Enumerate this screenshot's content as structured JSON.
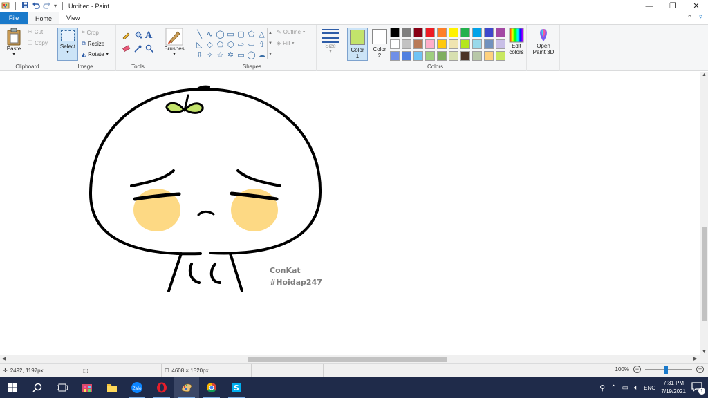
{
  "window": {
    "title": "Untitled - Paint"
  },
  "tabs": [
    {
      "label": "File"
    },
    {
      "label": "Home"
    },
    {
      "label": "View"
    }
  ],
  "ribbon": {
    "clipboard": {
      "label": "Clipboard",
      "paste": "Paste",
      "cut": "Cut",
      "copy": "Copy"
    },
    "image": {
      "label": "Image",
      "select": "Select",
      "crop": "Crop",
      "resize": "Resize",
      "rotate": "Rotate"
    },
    "tools": {
      "label": "Tools"
    },
    "brushes": {
      "label": "Brushes"
    },
    "shapes": {
      "label": "Shapes",
      "outline": "Outline",
      "fill": "Fill"
    },
    "size": {
      "label": "Size"
    },
    "colors": {
      "label": "Colors",
      "color1_label": "Color 1",
      "color1_value": "#c3e36b",
      "color2_label": "Color 2",
      "color2_value": "#ffffff",
      "edit_colors": "Edit colors",
      "palette": [
        "#000000",
        "#7f7f7f",
        "#880015",
        "#ed1c24",
        "#ff7f27",
        "#fff200",
        "#22b14c",
        "#00a2e8",
        "#3f48cc",
        "#a349a4",
        "#ffffff",
        "#c3c3c3",
        "#b97a57",
        "#ffaec9",
        "#ffc90e",
        "#efe4b0",
        "#b5e61d",
        "#99d9ea",
        "#7092be",
        "#c8bfe7",
        "#6f8fe8",
        "#4f7fe0",
        "#6fc3f5",
        "#9fcf7f",
        "#7fae5f",
        "#d7e0b0",
        "#4a3326",
        "#b8c8a8",
        "#ffd27f",
        "#c8e860"
      ]
    },
    "paint3d": {
      "label": "Open Paint 3D"
    }
  },
  "canvas": {
    "signature_line1": "ConKat",
    "signature_line2": "#Hoidap247"
  },
  "status": {
    "cursor_pos": "2492, 1197px",
    "image_size": "4608 × 1520px",
    "zoom": "100%",
    "zoom_fraction": 0.44
  },
  "taskbar": {
    "time": "7:31 PM",
    "date": "7/19/2021",
    "lang": "ENG",
    "notifications": "1"
  }
}
